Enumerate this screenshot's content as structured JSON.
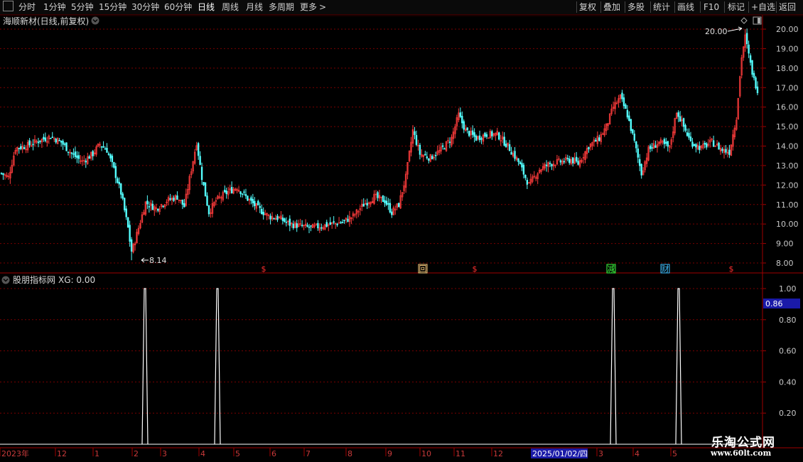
{
  "toolbar": {
    "left_items": [
      "分时",
      "1分钟",
      "5分钟",
      "15分钟",
      "30分钟",
      "60分钟",
      "日线",
      "周线",
      "月线",
      "多周期",
      "更多"
    ],
    "active_item": "日线",
    "more_arrow": ">",
    "right_items": [
      "复权",
      "叠加",
      "多股",
      "统计",
      "画线",
      "F10",
      "标记",
      "+自选",
      "返回"
    ]
  },
  "main_chart": {
    "title": "海顺新材(日线,前复权)",
    "y_ticks": [
      "20.00",
      "19.00",
      "18.00",
      "17.00",
      "16.00",
      "15.00",
      "14.00",
      "13.00",
      "12.00",
      "11.00",
      "10.00",
      "9.00",
      "8.00"
    ],
    "high_label": "20.00",
    "low_label": "8.14",
    "markers": [
      {
        "symbol": "$",
        "color": "#ff3030"
      },
      {
        "symbol": "回",
        "color": "#ffd080"
      },
      {
        "symbol": "$",
        "color": "#ff3030"
      },
      {
        "symbol": "减",
        "color": "#40ff40"
      },
      {
        "symbol": "财",
        "color": "#40c0ff"
      },
      {
        "symbol": "$",
        "color": "#ff3030"
      }
    ]
  },
  "indicator_panel": {
    "title": "股朋指标网",
    "readout": "XG: 0.00",
    "y_ticks": [
      "1.00",
      "0.80",
      "0.60",
      "0.40",
      "0.20"
    ],
    "cursor_value": "0.86"
  },
  "x_axis": {
    "labels": [
      "2023年",
      "12",
      "1",
      "2",
      "3",
      "4",
      "5",
      "6",
      "7",
      "8",
      "9",
      "10",
      "11",
      "12",
      "3",
      "4",
      "5"
    ],
    "cursor_date": "2025/01/02/四"
  },
  "watermark": {
    "line1": "乐淘公式网",
    "line2": "www.60lt.com"
  },
  "colors": {
    "up": "#ff3c3c",
    "down": "#54ffff",
    "grid": "#7a0000",
    "axis": "#a00000",
    "text": "#c8c8c8",
    "cursor_bg": "#1a1aa8",
    "signal": "#ffffff"
  },
  "chart_data": {
    "type": "candlestick",
    "title": "海顺新材(日线,前复权)",
    "ylim": [
      7.8,
      20.3
    ],
    "high": 20.0,
    "low": 8.14,
    "close_path": [
      {
        "bar": 0,
        "close": 12.6
      },
      {
        "bar": 4,
        "close": 12.4
      },
      {
        "bar": 8,
        "close": 13.9
      },
      {
        "bar": 14,
        "close": 14.0
      },
      {
        "bar": 22,
        "close": 14.3
      },
      {
        "bar": 28,
        "close": 14.5
      },
      {
        "bar": 34,
        "close": 14.2
      },
      {
        "bar": 40,
        "close": 13.6
      },
      {
        "bar": 46,
        "close": 13.2
      },
      {
        "bar": 52,
        "close": 13.6
      },
      {
        "bar": 56,
        "close": 14.1
      },
      {
        "bar": 60,
        "close": 13.8
      },
      {
        "bar": 64,
        "close": 12.8
      },
      {
        "bar": 68,
        "close": 11.6
      },
      {
        "bar": 72,
        "close": 9.8
      },
      {
        "bar": 74,
        "close": 8.5
      },
      {
        "bar": 78,
        "close": 9.8
      },
      {
        "bar": 82,
        "close": 11.1
      },
      {
        "bar": 88,
        "close": 10.8
      },
      {
        "bar": 94,
        "close": 11.2
      },
      {
        "bar": 100,
        "close": 11.4
      },
      {
        "bar": 104,
        "close": 10.9
      },
      {
        "bar": 108,
        "close": 12.8
      },
      {
        "bar": 111,
        "close": 14.2
      },
      {
        "bar": 114,
        "close": 12.4
      },
      {
        "bar": 118,
        "close": 10.6
      },
      {
        "bar": 122,
        "close": 11.2
      },
      {
        "bar": 128,
        "close": 11.6
      },
      {
        "bar": 134,
        "close": 11.9
      },
      {
        "bar": 140,
        "close": 11.3
      },
      {
        "bar": 146,
        "close": 10.8
      },
      {
        "bar": 152,
        "close": 10.4
      },
      {
        "bar": 158,
        "close": 10.3
      },
      {
        "bar": 164,
        "close": 10.0
      },
      {
        "bar": 170,
        "close": 9.9
      },
      {
        "bar": 176,
        "close": 9.8
      },
      {
        "bar": 182,
        "close": 9.9
      },
      {
        "bar": 188,
        "close": 10.0
      },
      {
        "bar": 194,
        "close": 10.1
      },
      {
        "bar": 200,
        "close": 10.4
      },
      {
        "bar": 206,
        "close": 11.0
      },
      {
        "bar": 212,
        "close": 11.4
      },
      {
        "bar": 218,
        "close": 11.2
      },
      {
        "bar": 222,
        "close": 10.6
      },
      {
        "bar": 226,
        "close": 11.0
      },
      {
        "bar": 230,
        "close": 12.4
      },
      {
        "bar": 234,
        "close": 14.8
      },
      {
        "bar": 238,
        "close": 13.6
      },
      {
        "bar": 244,
        "close": 13.4
      },
      {
        "bar": 250,
        "close": 13.8
      },
      {
        "bar": 256,
        "close": 14.4
      },
      {
        "bar": 260,
        "close": 15.6
      },
      {
        "bar": 264,
        "close": 14.8
      },
      {
        "bar": 270,
        "close": 14.4
      },
      {
        "bar": 276,
        "close": 14.6
      },
      {
        "bar": 282,
        "close": 14.6
      },
      {
        "bar": 288,
        "close": 14.0
      },
      {
        "bar": 294,
        "close": 13.2
      },
      {
        "bar": 300,
        "close": 12.0
      },
      {
        "bar": 306,
        "close": 12.8
      },
      {
        "bar": 312,
        "close": 13.1
      },
      {
        "bar": 318,
        "close": 13.2
      },
      {
        "bar": 324,
        "close": 13.3
      },
      {
        "bar": 328,
        "close": 13.1
      },
      {
        "bar": 334,
        "close": 14.0
      },
      {
        "bar": 340,
        "close": 14.4
      },
      {
        "bar": 344,
        "close": 15.0
      },
      {
        "bar": 348,
        "close": 16.0
      },
      {
        "bar": 352,
        "close": 16.5
      },
      {
        "bar": 356,
        "close": 15.6
      },
      {
        "bar": 360,
        "close": 14.2
      },
      {
        "bar": 364,
        "close": 12.6
      },
      {
        "bar": 368,
        "close": 13.8
      },
      {
        "bar": 374,
        "close": 14.2
      },
      {
        "bar": 380,
        "close": 13.9
      },
      {
        "bar": 384,
        "close": 15.8
      },
      {
        "bar": 388,
        "close": 15.0
      },
      {
        "bar": 392,
        "close": 14.2
      },
      {
        "bar": 398,
        "close": 13.9
      },
      {
        "bar": 404,
        "close": 14.2
      },
      {
        "bar": 410,
        "close": 13.8
      },
      {
        "bar": 414,
        "close": 13.7
      },
      {
        "bar": 418,
        "close": 15.5
      },
      {
        "bar": 421,
        "close": 18.6
      },
      {
        "bar": 423,
        "close": 19.6
      },
      {
        "bar": 426,
        "close": 18.2
      },
      {
        "bar": 428,
        "close": 17.4
      },
      {
        "bar": 430,
        "close": 16.9
      }
    ],
    "series": [
      {
        "name": "XG",
        "values_description_signal_count": 4,
        "signals": [
          {
            "bar": 84,
            "value": 1.0
          },
          {
            "bar": 126,
            "value": 1.0
          },
          {
            "bar": 355,
            "value": 1.0
          },
          {
            "bar": 392,
            "value": 1.0
          }
        ]
      }
    ],
    "indicator_ylim": [
      0,
      1.05
    ]
  }
}
